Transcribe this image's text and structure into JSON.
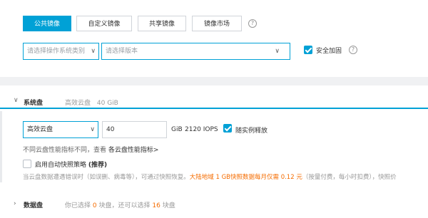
{
  "image_tabs": [
    {
      "label": "公共镜像",
      "active": true
    },
    {
      "label": "自定义镜像",
      "active": false
    },
    {
      "label": "共享镜像",
      "active": false
    },
    {
      "label": "镜像市场",
      "active": false
    }
  ],
  "os_select": {
    "placeholder": "请选择操作系统类别"
  },
  "version_select": {
    "placeholder": "请选择版本"
  },
  "security": {
    "label": "安全加固",
    "checked": true
  },
  "system_disk": {
    "title": "系统盘",
    "summary": "高效云盘",
    "summary_size": "40 GiB",
    "disk_type": "高效云盘",
    "size_value": "40",
    "unit": "GiB",
    "iops": "2120 IOPS",
    "release_label": "随实例释放",
    "release_checked": true,
    "perf_note": "不同云盘性能指标不同，查看",
    "perf_link": "各云盘性能指标>",
    "snapshot_label": "启用自动快照策略",
    "snapshot_recommend": "(推荐)",
    "snapshot_checked": false,
    "snapshot_note_prefix": "当云盘数据遭遇错误时（如误删、病毒等），可通过快照恢复。",
    "snapshot_note_highlight": "大陆地域 1 GB快照数据每月仅需 0.12 元",
    "snapshot_note_suffix": "（按量付费，每小时扣费），快照价"
  },
  "data_disk": {
    "title": "数据盘",
    "note_prefix": "你已选择",
    "selected_count": "0",
    "note_middle": "块盘，还可以选择",
    "remaining_count": "16",
    "note_suffix": "块盘"
  }
}
